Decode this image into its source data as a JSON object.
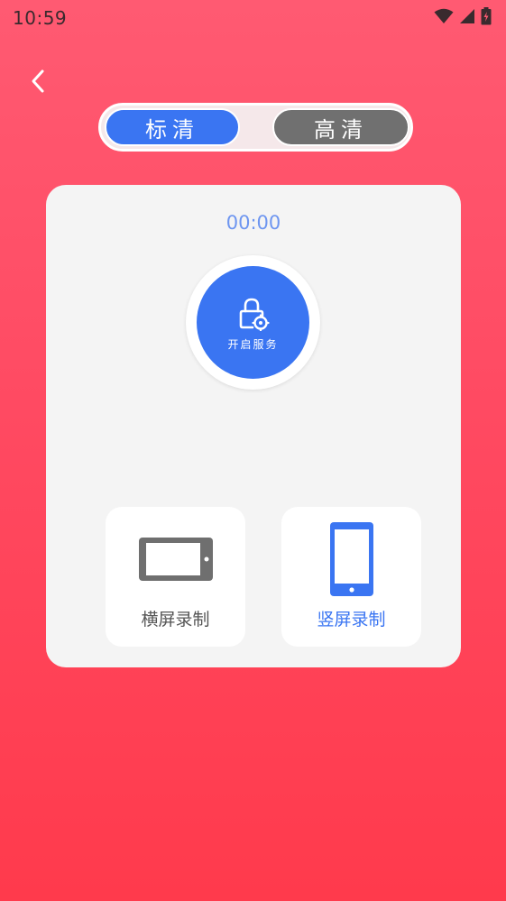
{
  "status_bar": {
    "time": "10:59",
    "icons": [
      "wifi-icon",
      "cellular-signal-icon",
      "battery-charging-icon"
    ]
  },
  "nav": {
    "back_icon": "chevron-left-icon"
  },
  "quality_switch": {
    "options": [
      {
        "label": "标清",
        "selected": true
      },
      {
        "label": "高清",
        "selected": false
      }
    ]
  },
  "recorder": {
    "timer": "00:00",
    "service_button": {
      "label": "开启服务",
      "icon": "lock-gear-icon"
    },
    "modes": [
      {
        "label": "横屏录制",
        "icon": "tablet-landscape-icon",
        "selected": false
      },
      {
        "label": "竖屏录制",
        "icon": "phone-portrait-icon",
        "selected": true
      }
    ]
  },
  "colors": {
    "background_top": "#ff5a72",
    "background_bottom": "#ff3a4c",
    "accent_blue": "#3a75f2",
    "gray_button": "#707070",
    "panel": "#f4f4f4",
    "timer_text": "#6e96f0"
  }
}
